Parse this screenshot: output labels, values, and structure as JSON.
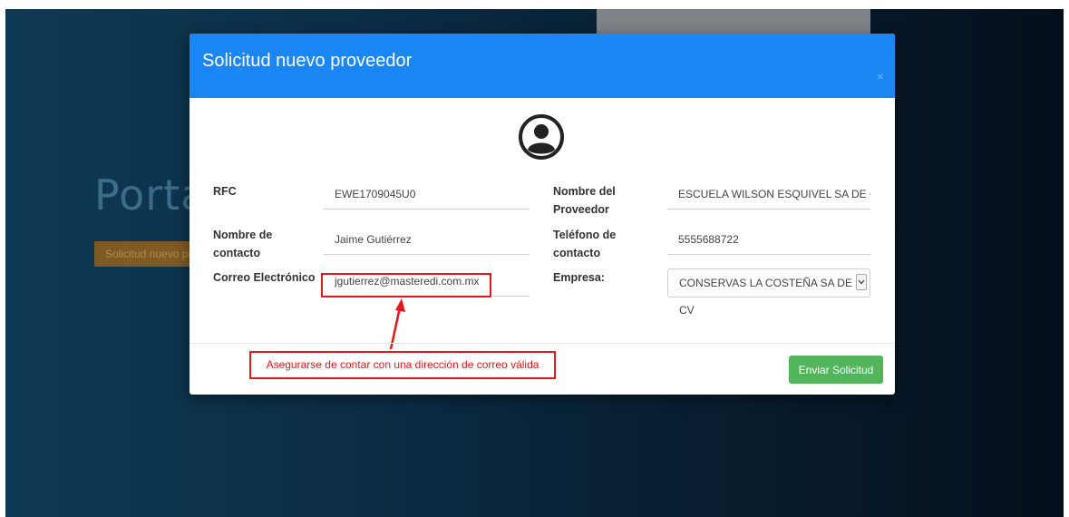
{
  "background": {
    "title": "Porta",
    "button_label": "Solicitud nuevo pr"
  },
  "modal": {
    "title": "Solicitud nuevo proveedor",
    "close_symbol": "×",
    "form": {
      "rfc_label": "RFC",
      "rfc_value": "EWE1709045U0",
      "nombre_proveedor_label_1": "Nombre del",
      "nombre_proveedor_label_2": "Proveedor",
      "nombre_proveedor_value": "ESCUELA WILSON ESQUIVEL SA DE CV",
      "nombre_contacto_label_1": "Nombre de",
      "nombre_contacto_label_2": "contacto",
      "nombre_contacto_value": "Jaime Gutiérrez",
      "telefono_label_1": "Teléfono de",
      "telefono_label_2": "contacto",
      "telefono_value": "5555688722",
      "correo_label": "Correo Electrónico",
      "correo_value": "jgutierrez@masteredi.com.mx",
      "empresa_label": "Empresa:",
      "empresa_selected": "CONSERVAS LA COSTEÑA SA DE CV"
    },
    "annotation_text": "Asegurarse de contar con una dirección de correo válida",
    "submit_label": "Enviar Solicitud"
  },
  "colors": {
    "header": "#1b87f5",
    "submit": "#52b55b",
    "annotation": "#e8161b"
  },
  "icons": {
    "avatar": "user-circle-icon",
    "close": "close-icon",
    "select_arrow": "chevron-down-icon"
  }
}
